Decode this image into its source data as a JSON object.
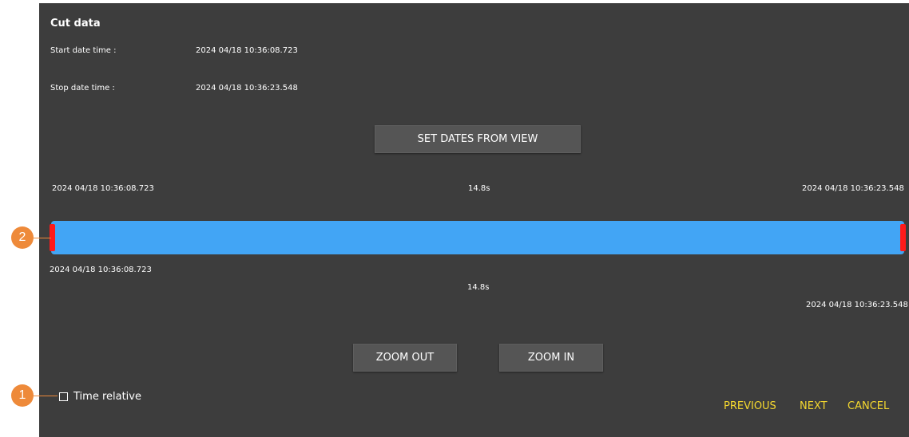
{
  "dialog": {
    "title": "Cut data",
    "start_label": "Start date time :",
    "start_value": "2024 04/18 10:36:08.723",
    "stop_label": "Stop date time :",
    "stop_value": "2024 04/18 10:36:23.548",
    "set_dates_button": "SET DATES FROM VIEW"
  },
  "timeline": {
    "top_left_time": "2024 04/18 10:36:08.723",
    "top_duration": "14.8s",
    "top_right_time": "2024 04/18 10:36:23.548",
    "bottom_left_time": "2024 04/18 10:36:08.723",
    "bottom_duration": "14.8s",
    "bottom_right_time": "2024 04/18 10:36:23.548",
    "bar_color": "#42a5f5",
    "handle_color": "#ff1a1a"
  },
  "zoom": {
    "out_label": "ZOOM OUT",
    "in_label": "ZOOM IN"
  },
  "options": {
    "time_relative_label": "Time relative",
    "time_relative_checked": false
  },
  "navigation": {
    "previous": "PREVIOUS",
    "next": "NEXT",
    "cancel": "CANCEL",
    "link_color": "#f5d82f"
  },
  "callouts": {
    "color": "#ee8a3a",
    "items": [
      {
        "number": "1",
        "target": "time-relative-checkbox"
      },
      {
        "number": "2",
        "target": "range-start-handle"
      }
    ]
  },
  "colors": {
    "panel_bg": "#3d3d3d",
    "button_bg": "#555555"
  }
}
